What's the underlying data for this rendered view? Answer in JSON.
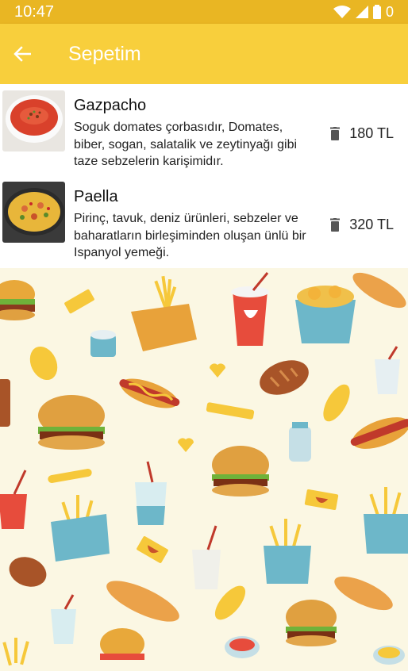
{
  "status_bar": {
    "time": "10:47",
    "battery": "0"
  },
  "app_bar": {
    "title": "Sepetim",
    "back_icon": "arrow-back-icon"
  },
  "cart": {
    "items": [
      {
        "name": "Gazpacho",
        "description": "Soguk domates çorbasıdır, Domates, biber, sogan, salatalik ve zeytinyağı gibi taze sebzelerin karişimidır.",
        "price": "180 TL",
        "image": "gazpacho-soup-image",
        "delete_icon": "trash-icon"
      },
      {
        "name": "Paella",
        "description": "Pirinç, tavuk, deniz ürünleri, sebzeler ve baharatların birleşiminden oluşan ünlü bir Ispanyol yemeği.",
        "price": "320 TL",
        "image": "paella-image",
        "delete_icon": "trash-icon"
      }
    ]
  },
  "background": {
    "name": "fast-food-pattern",
    "color": "#fbf7e3"
  },
  "colors": {
    "primary": "#f8cf3c",
    "status_bar": "#e9b623"
  }
}
